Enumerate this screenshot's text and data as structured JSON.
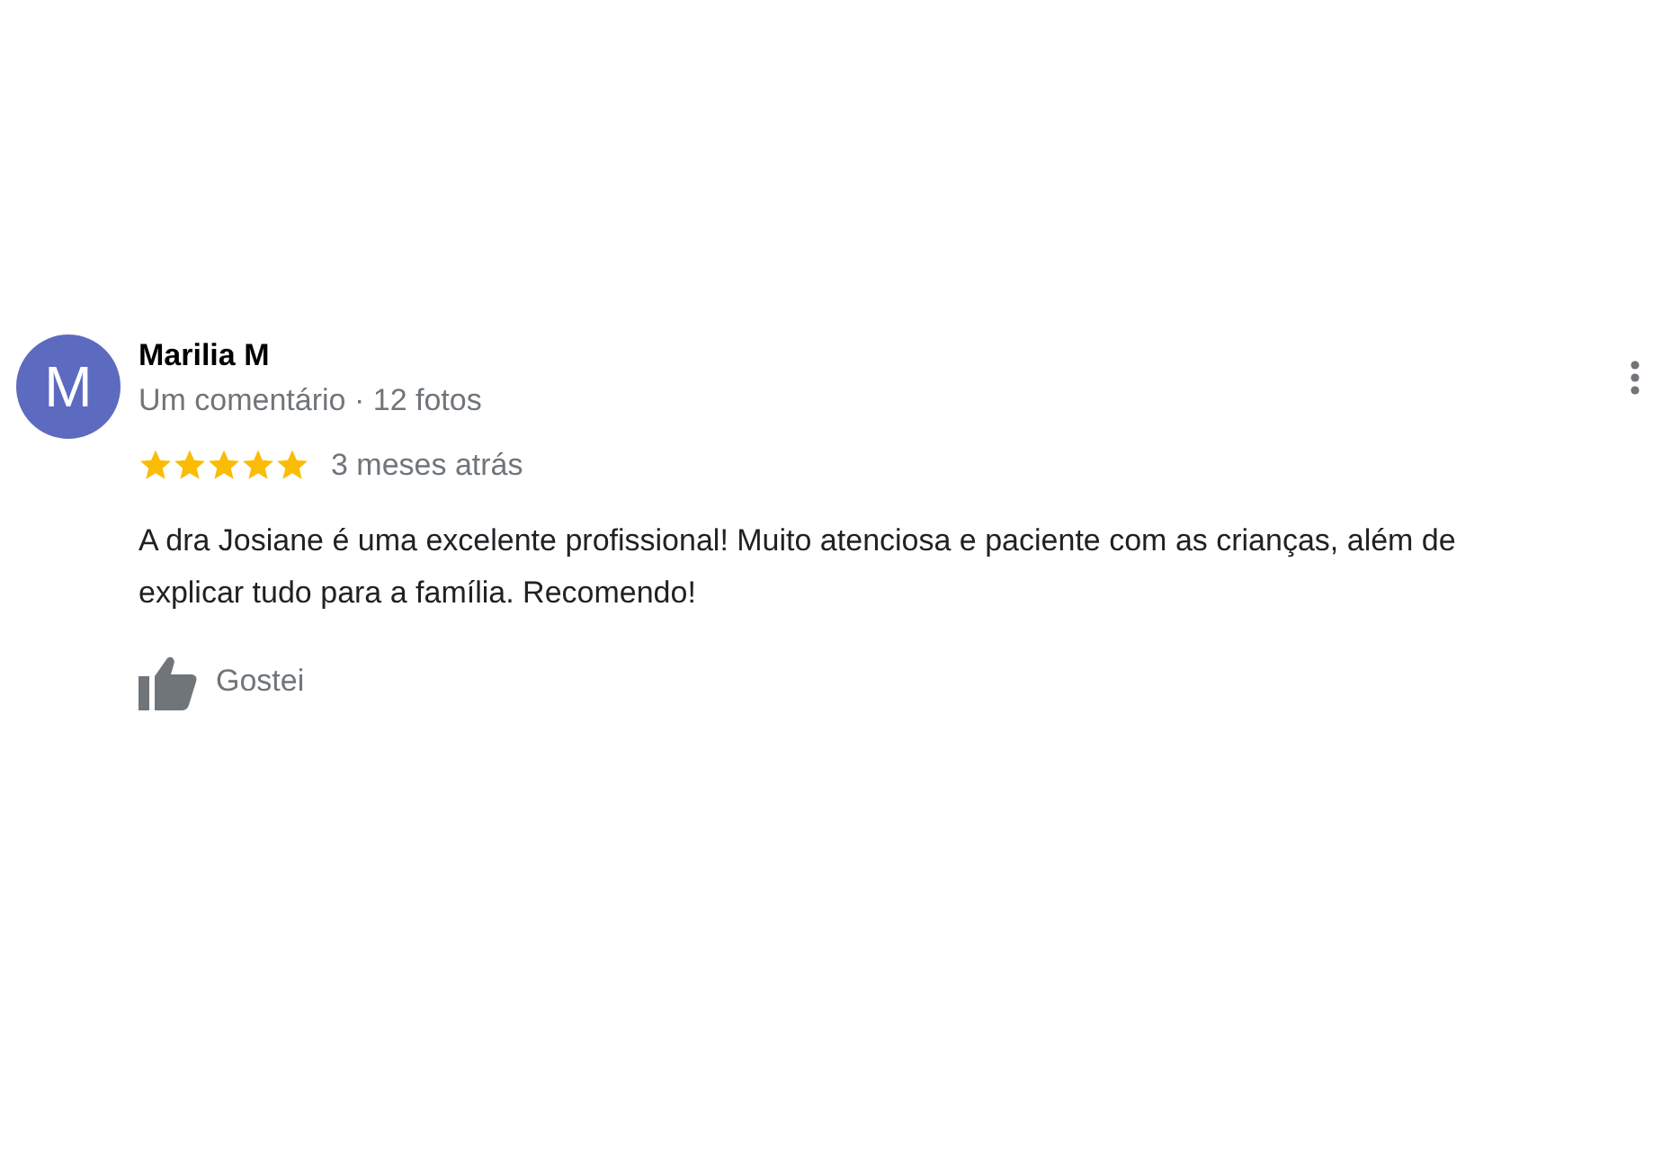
{
  "review": {
    "avatar_letter": "M",
    "author": "Marilia M",
    "meta": "Um comentário · 12 fotos",
    "stars": 5,
    "time": "3 meses atrás",
    "text": "A dra Josiane é uma excelente profissional! Muito atenciosa e paciente com as crianças, além de explicar tudo para a família. Recomendo!",
    "like_label": "Gostei"
  }
}
